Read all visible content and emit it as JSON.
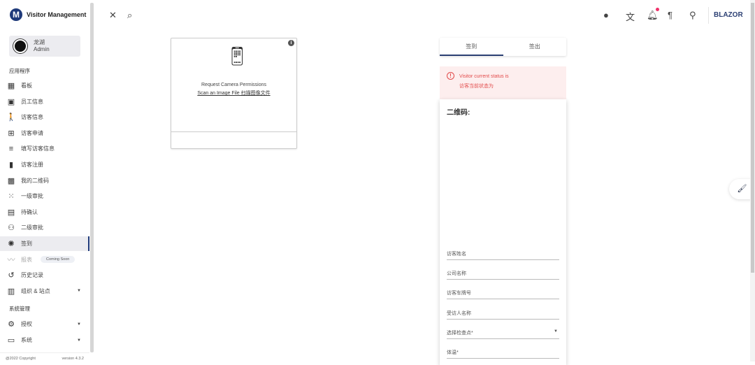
{
  "app": {
    "title": "Visitor Management",
    "logo_letter": "M"
  },
  "user": {
    "name": "龙湖",
    "role": "Admin"
  },
  "sidebar": {
    "section_apps": "应用程序",
    "items": [
      {
        "label": "看板",
        "icon": "dashboard-icon",
        "glyph": "▦"
      },
      {
        "label": "员工信息",
        "icon": "badge-icon",
        "glyph": "▣"
      },
      {
        "label": "访客信息",
        "icon": "person-walking-icon",
        "glyph": "🚶"
      },
      {
        "label": "访客申请",
        "icon": "note-add-icon",
        "glyph": "⊞"
      },
      {
        "label": "填写访客信息",
        "icon": "edit-list-icon",
        "glyph": "≡"
      },
      {
        "label": "访客注册",
        "icon": "bookmark-icon",
        "glyph": "▮"
      },
      {
        "label": "我的二维码",
        "icon": "qr-code-icon",
        "glyph": "▩"
      },
      {
        "label": "一级审批",
        "icon": "grid-check-icon",
        "glyph": "⁙"
      },
      {
        "label": "待确认",
        "icon": "fact-check-icon",
        "glyph": "▤"
      },
      {
        "label": "二级审批",
        "icon": "people-icon",
        "glyph": "⚇"
      },
      {
        "label": "签到",
        "icon": "shutter-icon",
        "glyph": "✺"
      },
      {
        "label": "报表",
        "icon": "chart-icon",
        "glyph": "〰",
        "badge": "Coming Soon"
      },
      {
        "label": "历史记录",
        "icon": "history-icon",
        "glyph": "↺"
      },
      {
        "label": "组织 & 站点",
        "icon": "building-icon",
        "glyph": "▥"
      }
    ],
    "section_system": "系统管理",
    "system_items": [
      {
        "label": "授权",
        "icon": "manage-accounts-icon",
        "glyph": "⚙"
      },
      {
        "label": "系统",
        "icon": "devices-icon",
        "glyph": "▭"
      }
    ],
    "footer_copyright": "@2022 Copyright",
    "footer_version": "version 4.3.2"
  },
  "header": {
    "brand": "BLAZOR"
  },
  "camera": {
    "request": "Request Camera Permissions",
    "scan": "Scan an Image File 扫描图像文件",
    "info": "i"
  },
  "tabs": [
    {
      "label": "签到"
    },
    {
      "label": "签出"
    }
  ],
  "alert": {
    "line1": "Visitor current status is",
    "line2": "访客当前状态为"
  },
  "form": {
    "title": "二维码:",
    "fields": [
      "访客姓名",
      "公司名称",
      "访客车牌号",
      "受访人名称",
      "选择检查点*",
      "体温*"
    ]
  }
}
